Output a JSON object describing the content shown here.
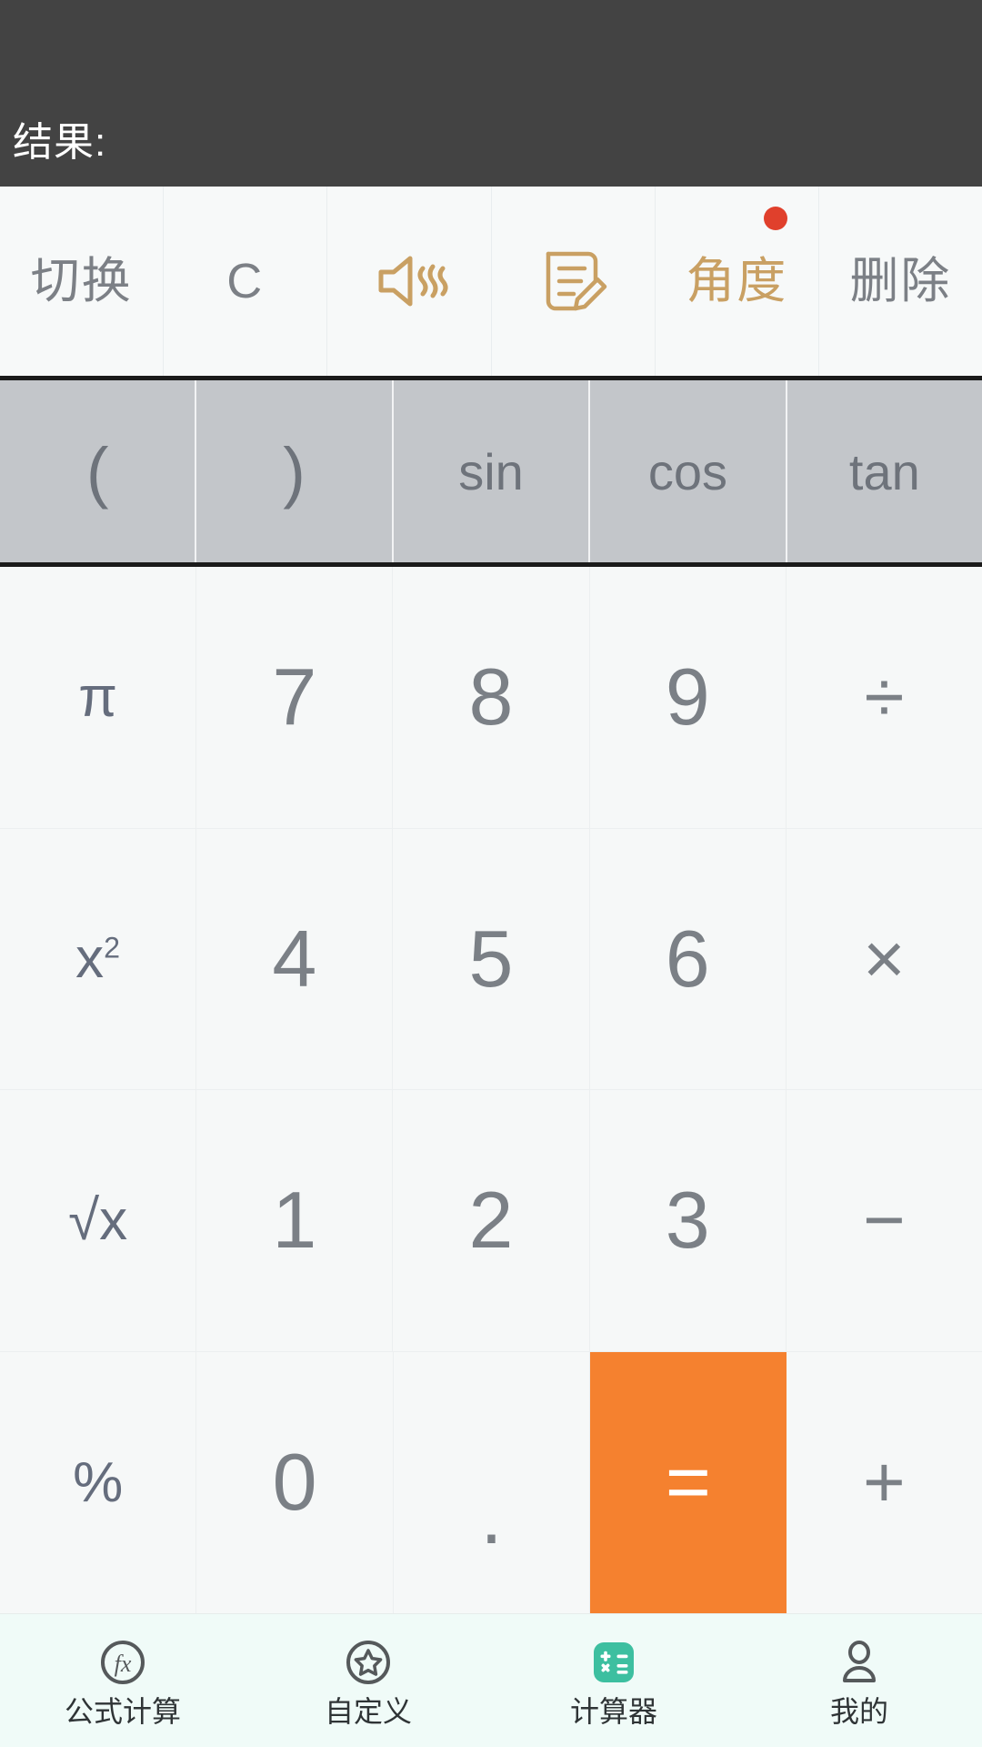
{
  "display": {
    "result_label": "结果:",
    "expression": "",
    "background": "#434343",
    "text_color": "#ffffff"
  },
  "function_row": {
    "keys": [
      {
        "id": "switch",
        "label": "切换",
        "type": "text",
        "icon": "",
        "accent": false,
        "badge": false
      },
      {
        "id": "clear",
        "label": "C",
        "type": "text",
        "icon": "",
        "accent": false,
        "badge": false
      },
      {
        "id": "sound",
        "label": "",
        "type": "icon",
        "icon": "speaker-sound-icon",
        "accent": true,
        "badge": false
      },
      {
        "id": "note",
        "label": "",
        "type": "icon",
        "icon": "note-edit-icon",
        "accent": true,
        "badge": false
      },
      {
        "id": "angle",
        "label": "角度",
        "type": "text",
        "icon": "",
        "accent": true,
        "badge": true
      },
      {
        "id": "delete",
        "label": "删除",
        "type": "text",
        "icon": "",
        "accent": false,
        "badge": false
      }
    ],
    "badge_color": "#e0402c",
    "accent_color": "#c9a063"
  },
  "trig_row": {
    "background": "#c3c6ca",
    "keys": [
      {
        "id": "paren-open",
        "label": "("
      },
      {
        "id": "paren-close",
        "label": ")"
      },
      {
        "id": "sin",
        "label": "sin"
      },
      {
        "id": "cos",
        "label": "cos"
      },
      {
        "id": "tan",
        "label": "tan"
      }
    ]
  },
  "keypad": {
    "rows": [
      [
        {
          "id": "pi",
          "label": "π",
          "kind": "sci"
        },
        {
          "id": "seven",
          "label": "7",
          "kind": "num"
        },
        {
          "id": "eight",
          "label": "8",
          "kind": "num"
        },
        {
          "id": "nine",
          "label": "9",
          "kind": "num"
        },
        {
          "id": "divide",
          "label": "÷",
          "kind": "op"
        }
      ],
      [
        {
          "id": "square",
          "label": "x²",
          "kind": "sci"
        },
        {
          "id": "four",
          "label": "4",
          "kind": "num"
        },
        {
          "id": "five",
          "label": "5",
          "kind": "num"
        },
        {
          "id": "six",
          "label": "6",
          "kind": "num"
        },
        {
          "id": "multiply",
          "label": "×",
          "kind": "op"
        }
      ],
      [
        {
          "id": "sqrt",
          "label": "√x",
          "kind": "sci"
        },
        {
          "id": "one",
          "label": "1",
          "kind": "num"
        },
        {
          "id": "two",
          "label": "2",
          "kind": "num"
        },
        {
          "id": "three",
          "label": "3",
          "kind": "num"
        },
        {
          "id": "minus",
          "label": "−",
          "kind": "op"
        }
      ],
      [
        {
          "id": "percent",
          "label": "%",
          "kind": "sci"
        },
        {
          "id": "zero",
          "label": "0",
          "kind": "num"
        },
        {
          "id": "decimal",
          "label": ".",
          "kind": "dot"
        },
        {
          "id": "equals",
          "label": "=",
          "kind": "equals"
        },
        {
          "id": "plus",
          "label": "+",
          "kind": "op"
        }
      ]
    ],
    "equals_color": "#f5812f",
    "key_background": "#f6f8f8",
    "key_text_color": "#7b8086"
  },
  "bottom_nav": {
    "active_color": "#3dbfa0",
    "items": [
      {
        "id": "formula",
        "label": "公式计算",
        "icon": "fx-circle-icon",
        "active": false
      },
      {
        "id": "custom",
        "label": "自定义",
        "icon": "star-circle-icon",
        "active": false
      },
      {
        "id": "calculator",
        "label": "计算器",
        "icon": "calculator-icon",
        "active": true
      },
      {
        "id": "mine",
        "label": "我的",
        "icon": "person-icon",
        "active": false
      }
    ]
  }
}
